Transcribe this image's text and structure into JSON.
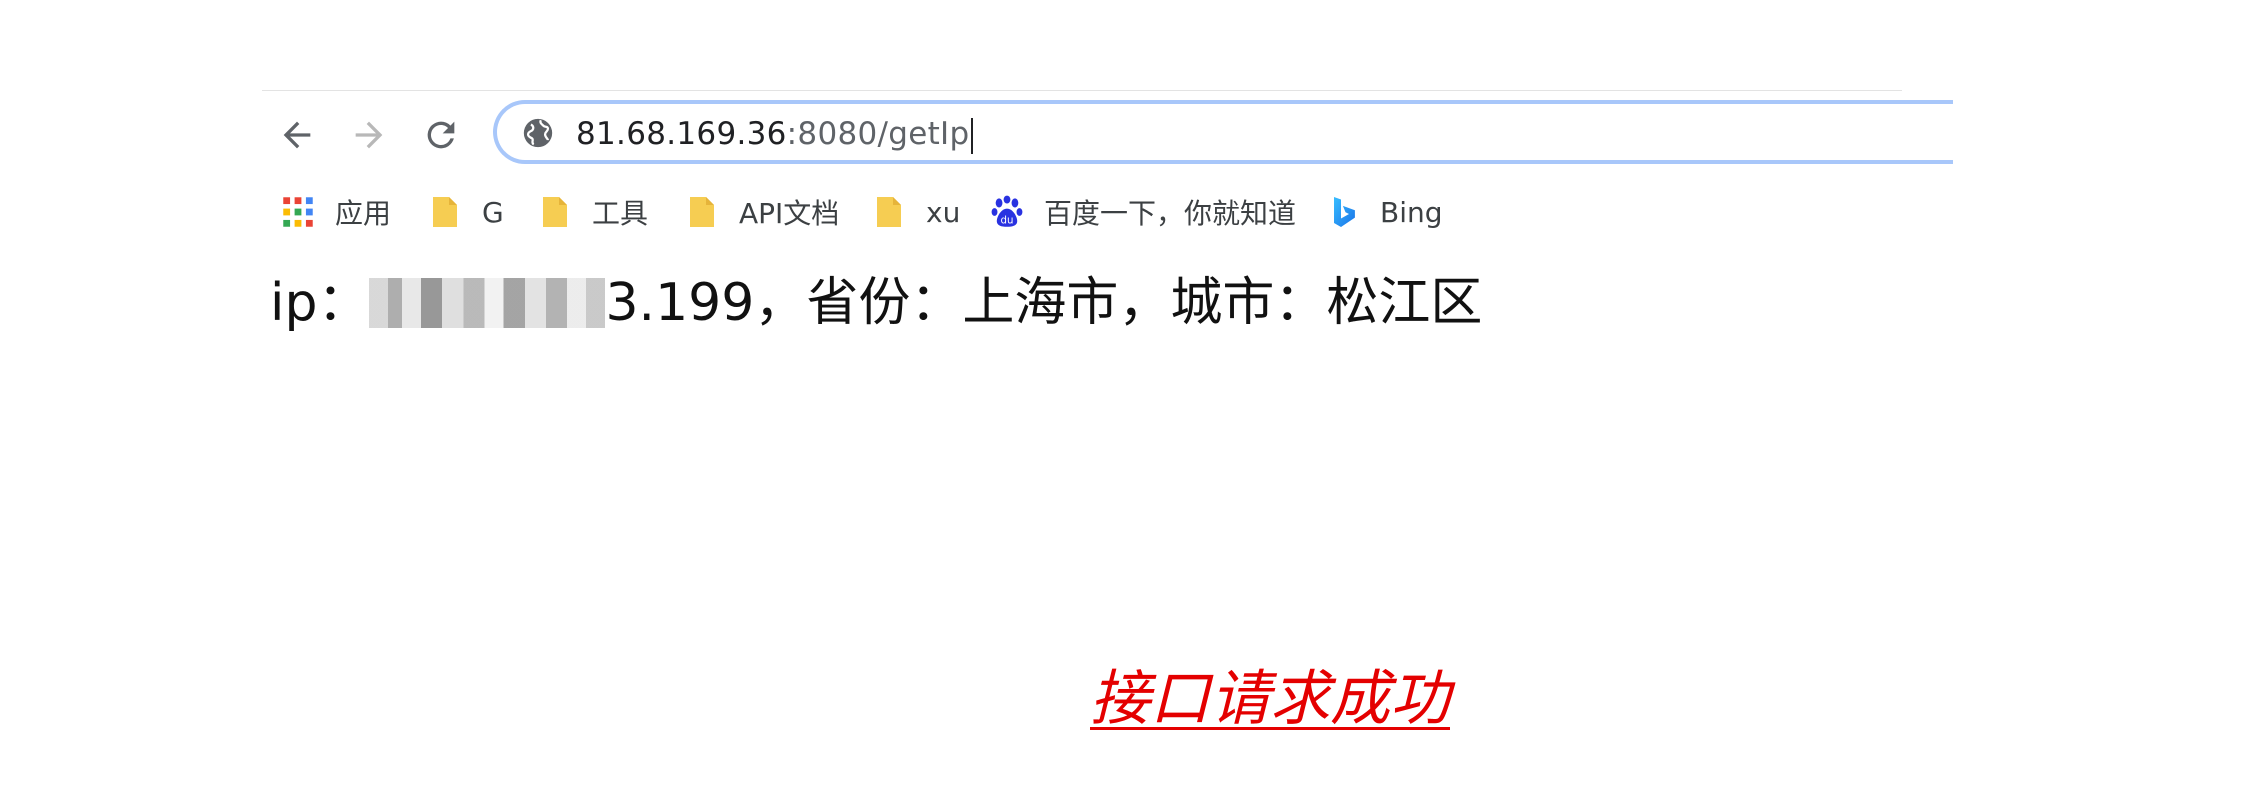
{
  "browser": {
    "url_host": "81.68.169.36",
    "url_rest": ":8080/getIp",
    "accent": "#a8c7fa",
    "icons": {
      "back": "arrow-left-icon",
      "forward": "arrow-right-icon",
      "reload": "reload-icon",
      "site": "globe-icon"
    },
    "bookmarks": [
      {
        "label": "应用",
        "icon": "apps-grid-icon"
      },
      {
        "label": "G",
        "icon": "folder-icon"
      },
      {
        "label": "工具",
        "icon": "folder-icon"
      },
      {
        "label": "API文档",
        "icon": "folder-icon"
      },
      {
        "label": "xu",
        "icon": "folder-icon"
      },
      {
        "label": "百度一下，你就知道",
        "icon": "baidu-paw-icon"
      },
      {
        "label": "Bing",
        "icon": "bing-icon"
      }
    ]
  },
  "content": {
    "ip_prefix": "ip：",
    "ip_visible_suffix": "3.199，省份：上海市，城市：松江区"
  },
  "success_text": "接口请求成功",
  "success_color": "#e40000"
}
